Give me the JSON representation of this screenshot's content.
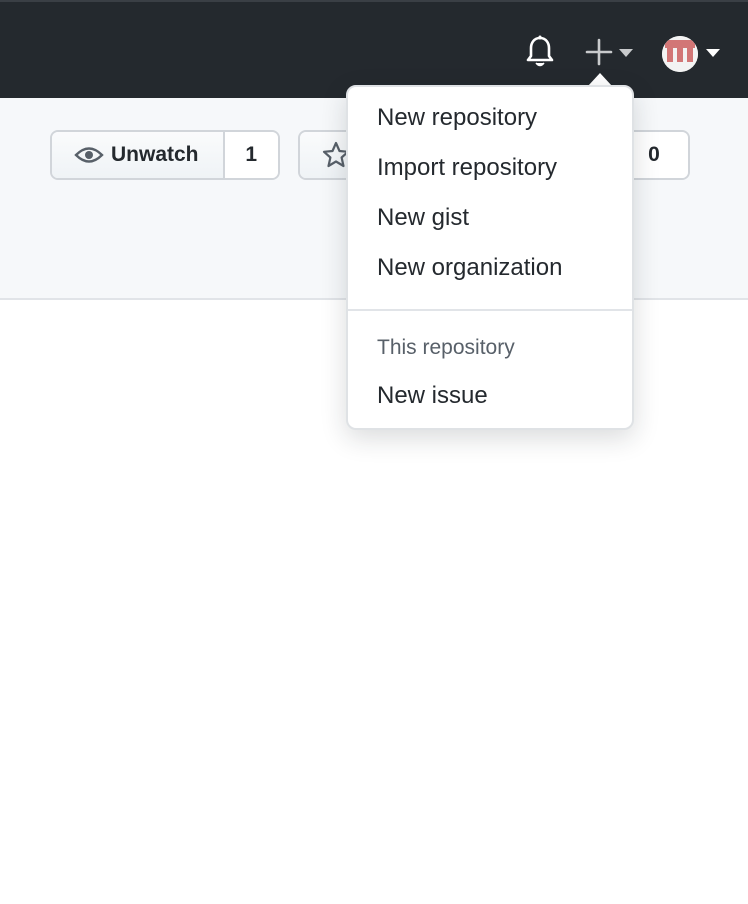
{
  "header": {
    "notifications_icon": "bell-icon",
    "create_icon": "plus-icon",
    "create_caret_icon": "caret-down-icon",
    "avatar_caret_icon": "caret-down-icon",
    "background_color": "#24292e"
  },
  "repo_actions": {
    "watch": {
      "label": "Unwatch",
      "count": "1",
      "icon": "eye-icon"
    },
    "star": {
      "icon": "star-icon"
    },
    "fork": {
      "count": "0"
    }
  },
  "create_menu": {
    "items": [
      {
        "label": "New repository"
      },
      {
        "label": "Import repository"
      },
      {
        "label": "New gist"
      },
      {
        "label": "New organization"
      }
    ],
    "section_header": "This repository",
    "section_items": [
      {
        "label": "New issue"
      }
    ]
  }
}
